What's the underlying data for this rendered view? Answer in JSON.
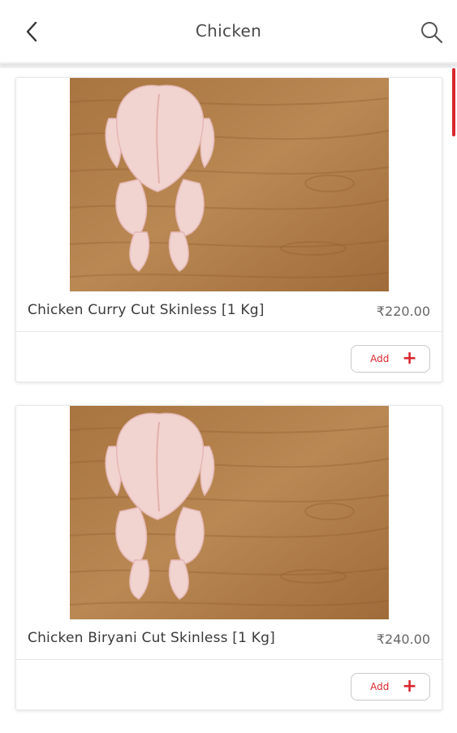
{
  "header": {
    "title": "Chicken",
    "back_icon": "chevron-left-icon",
    "search_icon": "search-icon"
  },
  "colors": {
    "accent": "#d9272e",
    "wood": "#b07d4a"
  },
  "products": [
    {
      "name": "Chicken Curry Cut Skinless [1 Kg]",
      "price": "₹220.00",
      "add_label": "Add",
      "add_icon": "plus-icon"
    },
    {
      "name": "Chicken Biryani Cut Skinless [1 Kg]",
      "price": "₹240.00",
      "add_label": "Add",
      "add_icon": "plus-icon"
    }
  ]
}
